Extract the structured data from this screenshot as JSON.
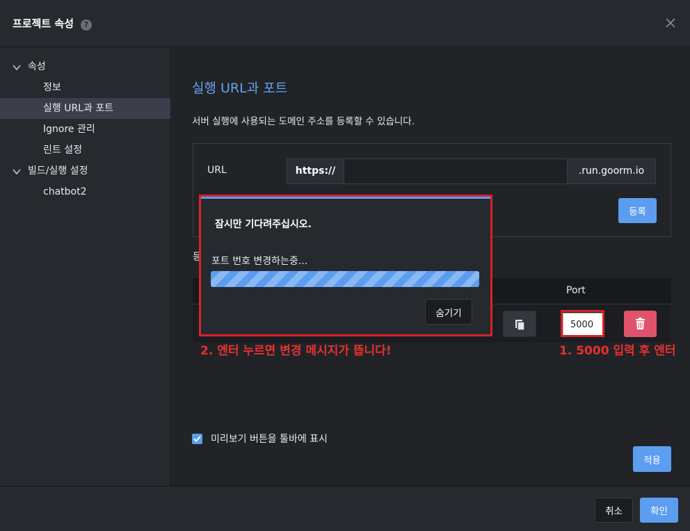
{
  "header": {
    "title": "프로젝트 속성",
    "help_icon": "?"
  },
  "sidebar": {
    "items": [
      {
        "label": "속성"
      },
      {
        "label": "정보"
      },
      {
        "label": "실행 URL과 포트"
      },
      {
        "label": "Ignore 관리"
      },
      {
        "label": "린트 설정"
      },
      {
        "label": "빌드/실행 설정"
      },
      {
        "label": "chatbot2"
      }
    ]
  },
  "main": {
    "section_title": "실행 URL과 포트",
    "description": "서버 실행에 사용되는 도메인 주소를 등록할 수 있습니다.",
    "url_label": "URL",
    "url_prefix": "https://",
    "url_value": "",
    "url_suffix": ".run.goorm.io",
    "register_label": "등록",
    "list_heading_fragment": "등",
    "port_column": "Port",
    "port_value": "5000",
    "preview_checkbox_label": "미리보기 버튼을 툴바에 표시",
    "preview_checked": true,
    "apply_label": "적용"
  },
  "modal": {
    "title": "잠시만 기다려주십시오.",
    "message": "포트 번호 변경하는중...",
    "hide_label": "숨기기"
  },
  "annotations": {
    "modal_note": "2. 엔터 누르면 변경 메시지가 뜹니다!",
    "port_note": "1. 5000 입력 후 엔터"
  },
  "footer": {
    "cancel_label": "취소",
    "ok_label": "확인"
  },
  "colors": {
    "accent": "#5c9df0",
    "danger": "#e1536b",
    "annotation": "#e8302f"
  }
}
